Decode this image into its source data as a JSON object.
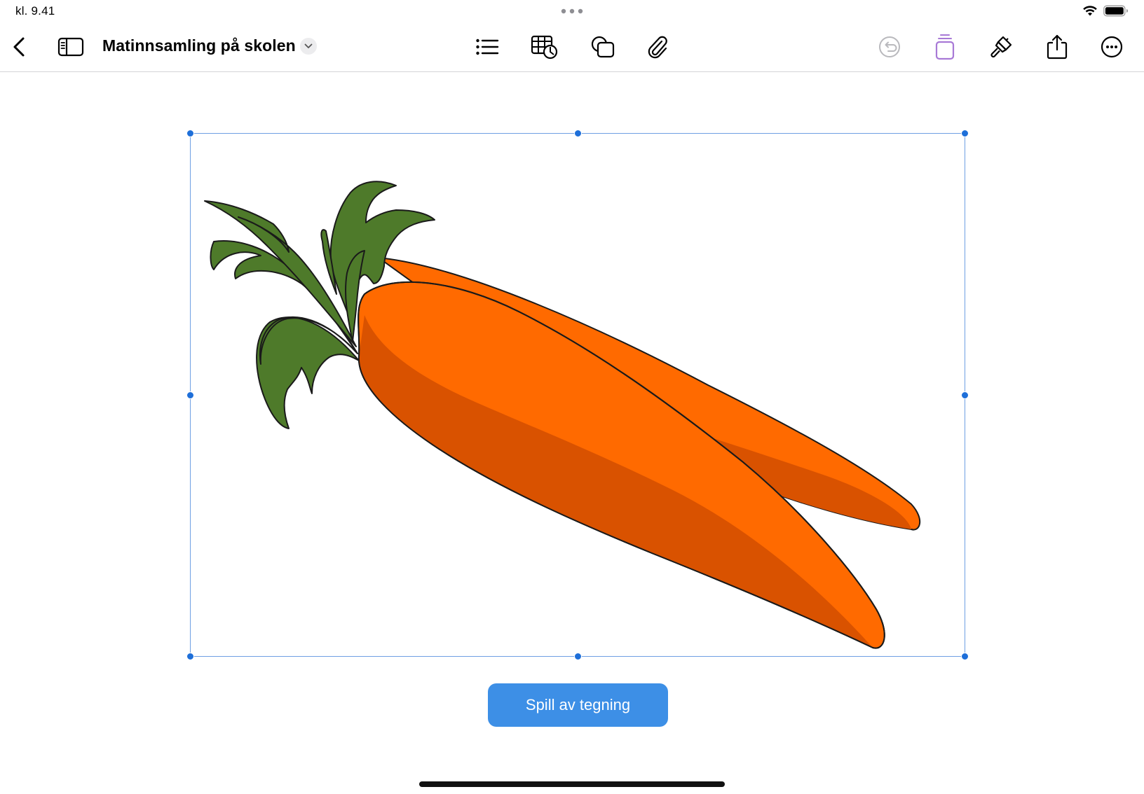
{
  "status_bar": {
    "time": "kl. 9.41"
  },
  "toolbar": {
    "document_title": "Matinnsamling på skolen",
    "icons": {
      "back": "chevron-left-icon",
      "sidebar": "sidebar-icon",
      "title_menu": "chevron-down-icon",
      "list": "list-icon",
      "table_chart": "table-chart-icon",
      "shapes": "shapes-icon",
      "attachment": "paperclip-icon",
      "undo": "undo-icon",
      "clipboard": "clipboard-icon",
      "format": "paintbrush-icon",
      "share": "share-icon",
      "more": "ellipsis-circle-icon"
    }
  },
  "canvas": {
    "drawing_subject": "carrot-drawing",
    "play_button_label": "Spill av tegning"
  },
  "colors": {
    "accent": "#3d8fe6",
    "selection": "#1e6fd9",
    "undo_disabled": "#b9b9bd",
    "clipboard_accent": "#a879d6",
    "carrot_light": "#ff6a00",
    "carrot_dark": "#d95200",
    "leaf": "#4e7a2a"
  }
}
